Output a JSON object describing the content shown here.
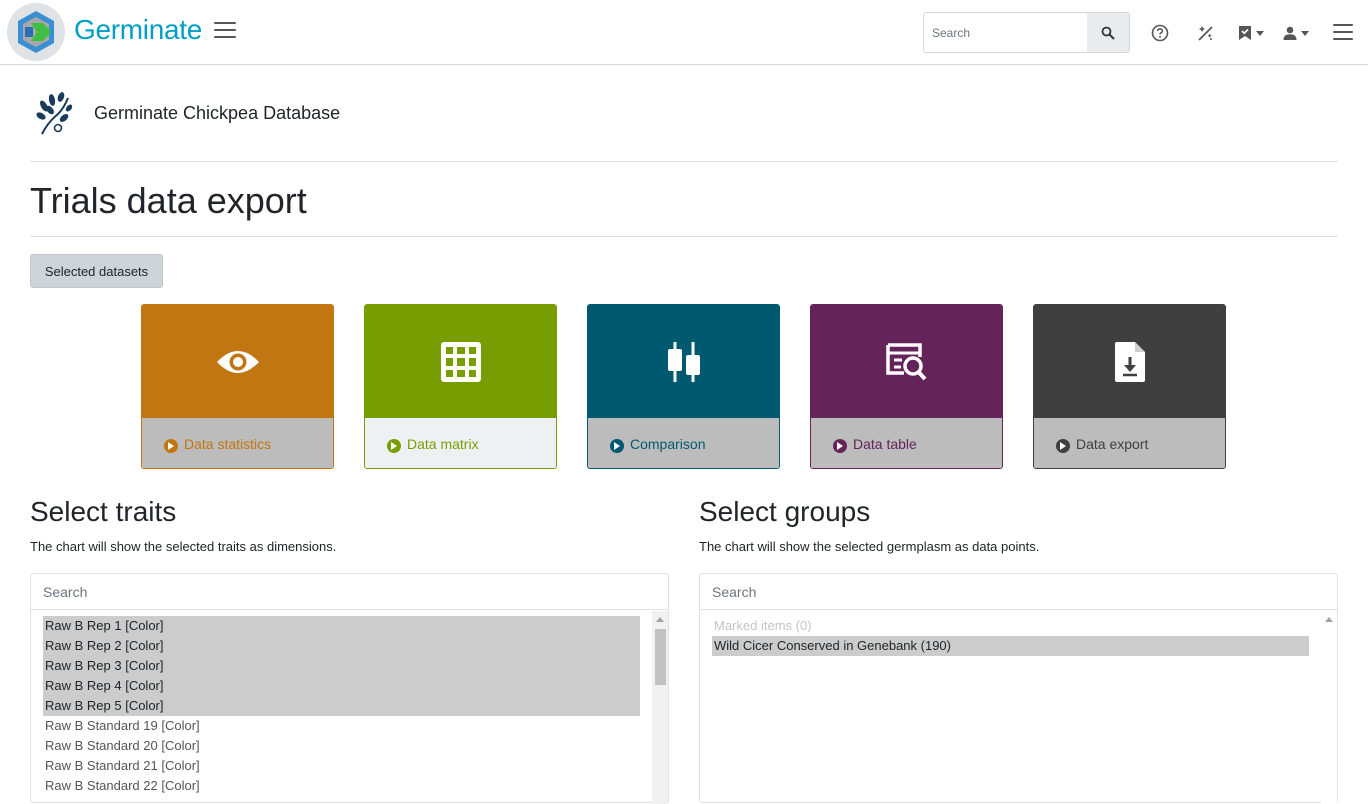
{
  "navbar": {
    "brand": "Germinate",
    "search_placeholder": "Search"
  },
  "header": {
    "database_title": "Germinate Chickpea Database",
    "page_title": "Trials data export",
    "selected_datasets_label": "Selected datasets"
  },
  "cards": [
    {
      "label": "Data statistics",
      "icon": "eye-icon",
      "color": "#c17612"
    },
    {
      "label": "Data matrix",
      "icon": "grid-icon",
      "color": "#789d02"
    },
    {
      "label": "Comparison",
      "icon": "comparison-icon",
      "color": "#00596f"
    },
    {
      "label": "Data table",
      "icon": "table-search-icon",
      "color": "#642459"
    },
    {
      "label": "Data export",
      "icon": "file-download-icon",
      "color": "#3f3f3f"
    }
  ],
  "traits": {
    "title": "Select traits",
    "description": "The chart will show the selected traits as dimensions.",
    "search_placeholder": "Search",
    "items": [
      {
        "label": "Raw B Rep 1 [Color]",
        "selected": true
      },
      {
        "label": "Raw B Rep 2 [Color]",
        "selected": true
      },
      {
        "label": "Raw B Rep 3 [Color]",
        "selected": true
      },
      {
        "label": "Raw B Rep 4 [Color]",
        "selected": true
      },
      {
        "label": "Raw B Rep 5 [Color]",
        "selected": true
      },
      {
        "label": "Raw B Standard 19 [Color]",
        "selected": false
      },
      {
        "label": "Raw B Standard 20 [Color]",
        "selected": false
      },
      {
        "label": "Raw B Standard 21 [Color]",
        "selected": false
      },
      {
        "label": "Raw B Standard 22 [Color]",
        "selected": false
      }
    ]
  },
  "groups": {
    "title": "Select groups",
    "description": "The chart will show the selected germplasm as data points.",
    "search_placeholder": "Search",
    "marked_items": "Marked items (0)",
    "items": [
      {
        "label": "Wild Cicer Conserved in Genebank (190)",
        "selected": true
      }
    ]
  }
}
